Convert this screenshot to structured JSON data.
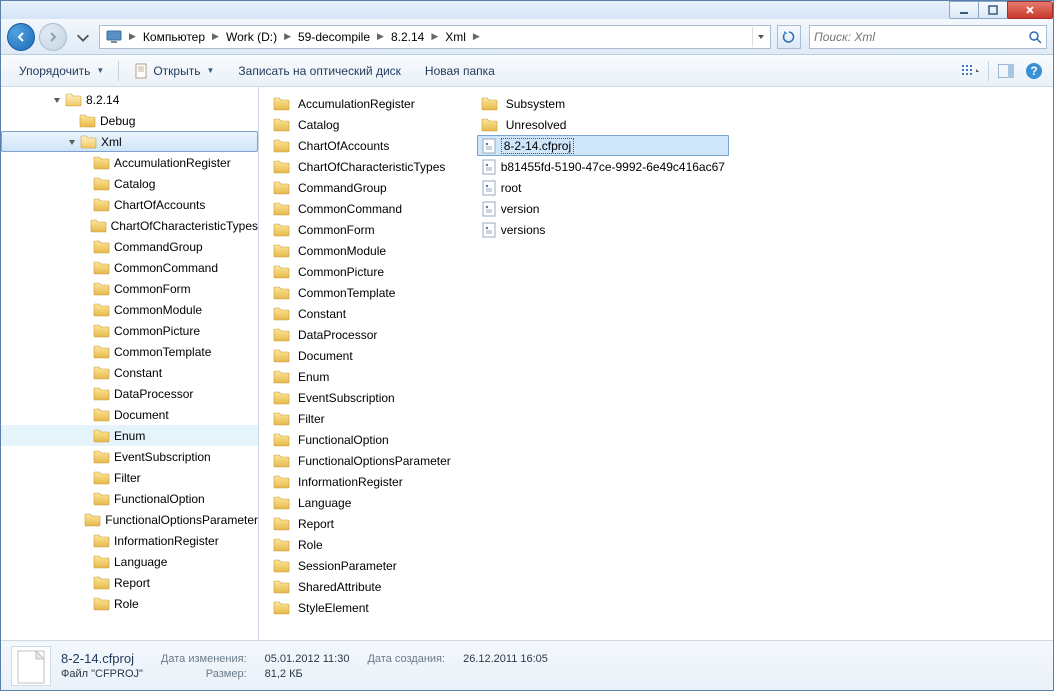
{
  "breadcrumbs": [
    "Компьютер",
    "Work (D:)",
    "59-decompile",
    "8.2.14",
    "Xml"
  ],
  "search_placeholder": "Поиск: Xml",
  "toolbar": {
    "organize": "Упорядочить",
    "open": "Открыть",
    "burn": "Записать на оптический диск",
    "newfolder": "Новая папка"
  },
  "tree": [
    {
      "label": "8.2.14",
      "indent": 1,
      "exp": "open"
    },
    {
      "label": "Debug",
      "indent": 2,
      "exp": "none"
    },
    {
      "label": "Xml",
      "indent": 2,
      "exp": "open",
      "selected": true
    },
    {
      "label": "AccumulationRegister",
      "indent": 3
    },
    {
      "label": "Catalog",
      "indent": 3
    },
    {
      "label": "ChartOfAccounts",
      "indent": 3
    },
    {
      "label": "ChartOfCharacteristicTypes",
      "indent": 3
    },
    {
      "label": "CommandGroup",
      "indent": 3
    },
    {
      "label": "CommonCommand",
      "indent": 3
    },
    {
      "label": "CommonForm",
      "indent": 3
    },
    {
      "label": "CommonModule",
      "indent": 3
    },
    {
      "label": "CommonPicture",
      "indent": 3
    },
    {
      "label": "CommonTemplate",
      "indent": 3
    },
    {
      "label": "Constant",
      "indent": 3
    },
    {
      "label": "DataProcessor",
      "indent": 3
    },
    {
      "label": "Document",
      "indent": 3
    },
    {
      "label": "Enum",
      "indent": 3,
      "hovered": true
    },
    {
      "label": "EventSubscription",
      "indent": 3
    },
    {
      "label": "Filter",
      "indent": 3
    },
    {
      "label": "FunctionalOption",
      "indent": 3
    },
    {
      "label": "FunctionalOptionsParameter",
      "indent": 3
    },
    {
      "label": "InformationRegister",
      "indent": 3
    },
    {
      "label": "Language",
      "indent": 3
    },
    {
      "label": "Report",
      "indent": 3
    },
    {
      "label": "Role",
      "indent": 3
    }
  ],
  "files_col1": [
    {
      "label": "AccumulationRegister",
      "type": "folder"
    },
    {
      "label": "Catalog",
      "type": "folder"
    },
    {
      "label": "ChartOfAccounts",
      "type": "folder"
    },
    {
      "label": "ChartOfCharacteristicTypes",
      "type": "folder"
    },
    {
      "label": "CommandGroup",
      "type": "folder"
    },
    {
      "label": "CommonCommand",
      "type": "folder"
    },
    {
      "label": "CommonForm",
      "type": "folder"
    },
    {
      "label": "CommonModule",
      "type": "folder"
    },
    {
      "label": "CommonPicture",
      "type": "folder"
    },
    {
      "label": "CommonTemplate",
      "type": "folder"
    },
    {
      "label": "Constant",
      "type": "folder"
    },
    {
      "label": "DataProcessor",
      "type": "folder"
    },
    {
      "label": "Document",
      "type": "folder"
    },
    {
      "label": "Enum",
      "type": "folder"
    },
    {
      "label": "EventSubscription",
      "type": "folder"
    },
    {
      "label": "Filter",
      "type": "folder"
    },
    {
      "label": "FunctionalOption",
      "type": "folder"
    },
    {
      "label": "FunctionalOptionsParameter",
      "type": "folder"
    },
    {
      "label": "InformationRegister",
      "type": "folder"
    },
    {
      "label": "Language",
      "type": "folder"
    },
    {
      "label": "Report",
      "type": "folder"
    },
    {
      "label": "Role",
      "type": "folder"
    },
    {
      "label": "SessionParameter",
      "type": "folder"
    },
    {
      "label": "SharedAttribute",
      "type": "folder"
    },
    {
      "label": "StyleElement",
      "type": "folder"
    }
  ],
  "files_col2": [
    {
      "label": "Subsystem",
      "type": "folder"
    },
    {
      "label": "Unresolved",
      "type": "folder"
    },
    {
      "label": "8-2-14.cfproj",
      "type": "file",
      "selected": true
    },
    {
      "label": "b81455fd-5190-47ce-9992-6e49c416ac67",
      "type": "file"
    },
    {
      "label": "root",
      "type": "file"
    },
    {
      "label": "version",
      "type": "file"
    },
    {
      "label": "versions",
      "type": "file"
    }
  ],
  "details": {
    "name": "8-2-14.cfproj",
    "type_lbl": "Файл \"CFPROJ\"",
    "mod_lbl": "Дата изменения:",
    "mod_val": "05.01.2012 11:30",
    "size_lbl": "Размер:",
    "size_val": "81,2 КБ",
    "created_lbl": "Дата создания:",
    "created_val": "26.12.2011 16:05"
  }
}
